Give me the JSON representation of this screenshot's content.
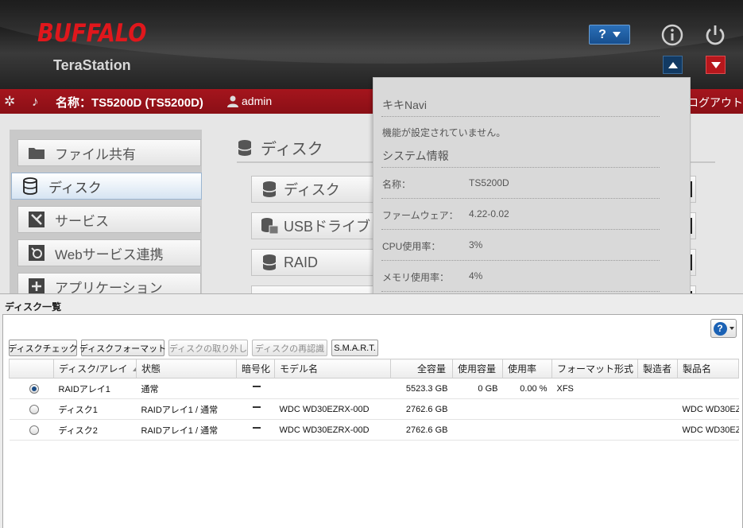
{
  "header": {
    "logo": "BUFFALO",
    "product": "TeraStation",
    "help_label": "?"
  },
  "topbar": {
    "name_label": "名称：TS5200D (TS5200D)",
    "user": "admin",
    "logout": "ログアウト"
  },
  "sidebar": {
    "items": [
      {
        "label": "ファイル共有",
        "icon": "folder-icon"
      },
      {
        "label": "ディスク",
        "icon": "database-icon"
      },
      {
        "label": "サービス",
        "icon": "service-icon"
      },
      {
        "label": "Webサービス連携",
        "icon": "web-service-icon"
      },
      {
        "label": "アプリケーション",
        "icon": "application-icon"
      }
    ]
  },
  "main": {
    "title": "ディスク",
    "items": [
      {
        "label": "ディスク",
        "icon": "database-icon"
      },
      {
        "label": "USBドライブ",
        "icon": "usb-drive-icon"
      },
      {
        "label": "RAID",
        "icon": "database-icon"
      }
    ]
  },
  "popup": {
    "kikinavi_title": "キキNavi",
    "kikinavi_message": "機能が設定されていません。",
    "sysinfo_title": "システム情報",
    "rows": [
      {
        "label": "名称：",
        "value": "TS5200D"
      },
      {
        "label": "ファームウェア：",
        "value": "4.22-0.02"
      },
      {
        "label": "CPU使用率：",
        "value": "3%"
      },
      {
        "label": "メモリ使用率：",
        "value": "4%"
      }
    ]
  },
  "dialog": {
    "title": "ディスク一覧",
    "toolbar": {
      "check": "ディスクチェック",
      "format": "ディスクフォーマット",
      "remove": "ディスクの取り外し",
      "rerecognize": "ディスクの再認識",
      "smart": "S.M.A.R.T."
    },
    "columns": [
      "ディスク/アレイ",
      "状態",
      "暗号化",
      "モデル名",
      "全容量",
      "使用容量",
      "使用率",
      "フォーマット形式",
      "製造者",
      "製品名"
    ],
    "rows": [
      {
        "selected": true,
        "name": "RAIDアレイ1",
        "status": "通常",
        "model": "",
        "capacity": "5523.3 GB",
        "used": "0 GB",
        "usage": "0.00 %",
        "format": "XFS",
        "maker": "",
        "product": ""
      },
      {
        "selected": false,
        "name": "ディスク1",
        "status": "RAIDアレイ1 / 通常",
        "model": "WDC WD30EZRX-00D",
        "capacity": "2762.6 GB",
        "used": "",
        "usage": "",
        "format": "",
        "maker": "",
        "product": "WDC WD30EZ"
      },
      {
        "selected": false,
        "name": "ディスク2",
        "status": "RAIDアレイ1 / 通常",
        "model": "WDC WD30EZRX-00D",
        "capacity": "2762.6 GB",
        "used": "",
        "usage": "",
        "format": "",
        "maker": "",
        "product": "WDC WD30EZ"
      }
    ]
  }
}
